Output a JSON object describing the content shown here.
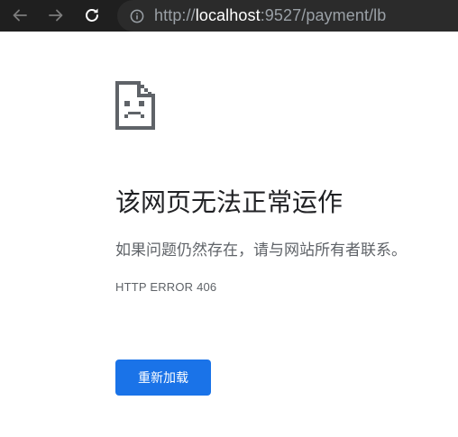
{
  "browser": {
    "url_prefix": "http://",
    "url_host": "localhost",
    "url_rest": ":9527/payment/lb"
  },
  "error_page": {
    "title": "该网页无法正常运作",
    "message": "如果问题仍然存在，请与网站所有者联系。",
    "code": "HTTP ERROR 406",
    "reload_label": "重新加载"
  },
  "colors": {
    "toolbar_bg": "#1f1f1f",
    "omnibox_bg": "#2b2b2b",
    "button_blue": "#1a73e8",
    "title_text": "#202124",
    "secondary_text": "#5f6368"
  },
  "icons": {
    "back": "arrow-left-icon",
    "forward": "arrow-right-icon",
    "reload": "reload-icon",
    "site_info": "info-icon",
    "error": "sad-document-icon"
  }
}
